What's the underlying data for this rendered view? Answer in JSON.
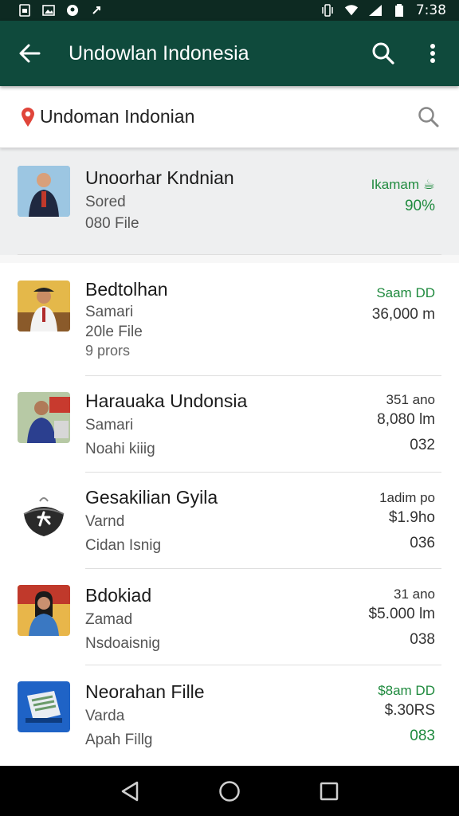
{
  "status_bar": {
    "time": "7:38"
  },
  "app_bar": {
    "title": "Undowlan Indonesia"
  },
  "search": {
    "value": "Undoman Indonian"
  },
  "colors": {
    "primary": "#0f4a3c",
    "status": "#0d2a22",
    "green_text": "#1f8a3e",
    "dark_text": "#333333"
  },
  "items": [
    {
      "title": "Unoorhar Kndnian",
      "line2": "Sored",
      "line3": "080 File",
      "line4": "",
      "right1": "Ikamam ☕",
      "right2": "90%",
      "right3": "",
      "right_color": "green"
    },
    {
      "title": "Bedtolhan",
      "line2": "Samari",
      "line3": "20le File",
      "line4": "9 prors",
      "right1": "Saam DD",
      "right2": "36,000 m",
      "right3": "",
      "right_color": "mixed"
    },
    {
      "title": "Harauaka Undonsia",
      "line2": "Samari",
      "line3": "Noahi kiiig",
      "line4": "",
      "right1": "351 ano",
      "right2": "8,080 lm",
      "right3": "032",
      "right_color": "dark"
    },
    {
      "title": "Gesakilian Gyila",
      "line2": "Varnd",
      "line3": "Cidan Isnig",
      "line4": "",
      "right1": "1adim po",
      "right2": "$1.9ho",
      "right3": "036",
      "right_color": "dark"
    },
    {
      "title": "Bdokiad",
      "line2": "Zamad",
      "line3": "Nsdoaisnig",
      "line4": "",
      "right1": "31 ano",
      "right2": "$5.000 lm",
      "right3": "038",
      "right_color": "dark"
    },
    {
      "title": "Neorahan Fille",
      "line2": "Varda",
      "line3": "Apah Fillg",
      "line4": "",
      "right1": "$8am DD",
      "right2": "$.30RS",
      "right3": "083",
      "right_color": "green-mixed"
    }
  ]
}
